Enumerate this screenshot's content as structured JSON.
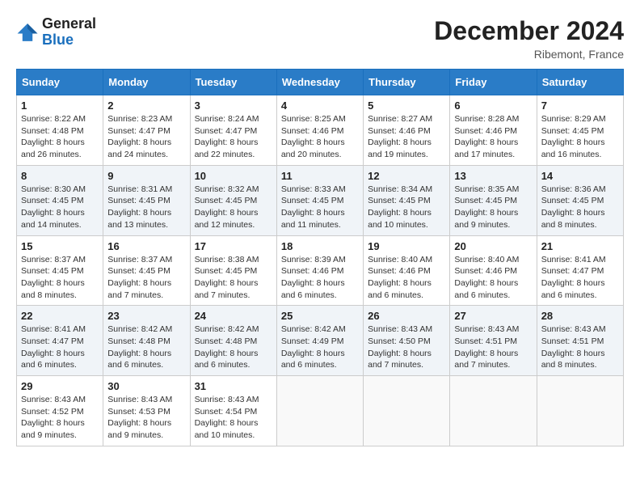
{
  "header": {
    "logo_line1": "General",
    "logo_line2": "Blue",
    "month_year": "December 2024",
    "location": "Ribemont, France"
  },
  "weekdays": [
    "Sunday",
    "Monday",
    "Tuesday",
    "Wednesday",
    "Thursday",
    "Friday",
    "Saturday"
  ],
  "weeks": [
    [
      {
        "day": "1",
        "sunrise": "Sunrise: 8:22 AM",
        "sunset": "Sunset: 4:48 PM",
        "daylight": "Daylight: 8 hours and 26 minutes."
      },
      {
        "day": "2",
        "sunrise": "Sunrise: 8:23 AM",
        "sunset": "Sunset: 4:47 PM",
        "daylight": "Daylight: 8 hours and 24 minutes."
      },
      {
        "day": "3",
        "sunrise": "Sunrise: 8:24 AM",
        "sunset": "Sunset: 4:47 PM",
        "daylight": "Daylight: 8 hours and 22 minutes."
      },
      {
        "day": "4",
        "sunrise": "Sunrise: 8:25 AM",
        "sunset": "Sunset: 4:46 PM",
        "daylight": "Daylight: 8 hours and 20 minutes."
      },
      {
        "day": "5",
        "sunrise": "Sunrise: 8:27 AM",
        "sunset": "Sunset: 4:46 PM",
        "daylight": "Daylight: 8 hours and 19 minutes."
      },
      {
        "day": "6",
        "sunrise": "Sunrise: 8:28 AM",
        "sunset": "Sunset: 4:46 PM",
        "daylight": "Daylight: 8 hours and 17 minutes."
      },
      {
        "day": "7",
        "sunrise": "Sunrise: 8:29 AM",
        "sunset": "Sunset: 4:45 PM",
        "daylight": "Daylight: 8 hours and 16 minutes."
      }
    ],
    [
      {
        "day": "8",
        "sunrise": "Sunrise: 8:30 AM",
        "sunset": "Sunset: 4:45 PM",
        "daylight": "Daylight: 8 hours and 14 minutes."
      },
      {
        "day": "9",
        "sunrise": "Sunrise: 8:31 AM",
        "sunset": "Sunset: 4:45 PM",
        "daylight": "Daylight: 8 hours and 13 minutes."
      },
      {
        "day": "10",
        "sunrise": "Sunrise: 8:32 AM",
        "sunset": "Sunset: 4:45 PM",
        "daylight": "Daylight: 8 hours and 12 minutes."
      },
      {
        "day": "11",
        "sunrise": "Sunrise: 8:33 AM",
        "sunset": "Sunset: 4:45 PM",
        "daylight": "Daylight: 8 hours and 11 minutes."
      },
      {
        "day": "12",
        "sunrise": "Sunrise: 8:34 AM",
        "sunset": "Sunset: 4:45 PM",
        "daylight": "Daylight: 8 hours and 10 minutes."
      },
      {
        "day": "13",
        "sunrise": "Sunrise: 8:35 AM",
        "sunset": "Sunset: 4:45 PM",
        "daylight": "Daylight: 8 hours and 9 minutes."
      },
      {
        "day": "14",
        "sunrise": "Sunrise: 8:36 AM",
        "sunset": "Sunset: 4:45 PM",
        "daylight": "Daylight: 8 hours and 8 minutes."
      }
    ],
    [
      {
        "day": "15",
        "sunrise": "Sunrise: 8:37 AM",
        "sunset": "Sunset: 4:45 PM",
        "daylight": "Daylight: 8 hours and 8 minutes."
      },
      {
        "day": "16",
        "sunrise": "Sunrise: 8:37 AM",
        "sunset": "Sunset: 4:45 PM",
        "daylight": "Daylight: 8 hours and 7 minutes."
      },
      {
        "day": "17",
        "sunrise": "Sunrise: 8:38 AM",
        "sunset": "Sunset: 4:45 PM",
        "daylight": "Daylight: 8 hours and 7 minutes."
      },
      {
        "day": "18",
        "sunrise": "Sunrise: 8:39 AM",
        "sunset": "Sunset: 4:46 PM",
        "daylight": "Daylight: 8 hours and 6 minutes."
      },
      {
        "day": "19",
        "sunrise": "Sunrise: 8:40 AM",
        "sunset": "Sunset: 4:46 PM",
        "daylight": "Daylight: 8 hours and 6 minutes."
      },
      {
        "day": "20",
        "sunrise": "Sunrise: 8:40 AM",
        "sunset": "Sunset: 4:46 PM",
        "daylight": "Daylight: 8 hours and 6 minutes."
      },
      {
        "day": "21",
        "sunrise": "Sunrise: 8:41 AM",
        "sunset": "Sunset: 4:47 PM",
        "daylight": "Daylight: 8 hours and 6 minutes."
      }
    ],
    [
      {
        "day": "22",
        "sunrise": "Sunrise: 8:41 AM",
        "sunset": "Sunset: 4:47 PM",
        "daylight": "Daylight: 8 hours and 6 minutes."
      },
      {
        "day": "23",
        "sunrise": "Sunrise: 8:42 AM",
        "sunset": "Sunset: 4:48 PM",
        "daylight": "Daylight: 8 hours and 6 minutes."
      },
      {
        "day": "24",
        "sunrise": "Sunrise: 8:42 AM",
        "sunset": "Sunset: 4:48 PM",
        "daylight": "Daylight: 8 hours and 6 minutes."
      },
      {
        "day": "25",
        "sunrise": "Sunrise: 8:42 AM",
        "sunset": "Sunset: 4:49 PM",
        "daylight": "Daylight: 8 hours and 6 minutes."
      },
      {
        "day": "26",
        "sunrise": "Sunrise: 8:43 AM",
        "sunset": "Sunset: 4:50 PM",
        "daylight": "Daylight: 8 hours and 7 minutes."
      },
      {
        "day": "27",
        "sunrise": "Sunrise: 8:43 AM",
        "sunset": "Sunset: 4:51 PM",
        "daylight": "Daylight: 8 hours and 7 minutes."
      },
      {
        "day": "28",
        "sunrise": "Sunrise: 8:43 AM",
        "sunset": "Sunset: 4:51 PM",
        "daylight": "Daylight: 8 hours and 8 minutes."
      }
    ],
    [
      {
        "day": "29",
        "sunrise": "Sunrise: 8:43 AM",
        "sunset": "Sunset: 4:52 PM",
        "daylight": "Daylight: 8 hours and 9 minutes."
      },
      {
        "day": "30",
        "sunrise": "Sunrise: 8:43 AM",
        "sunset": "Sunset: 4:53 PM",
        "daylight": "Daylight: 8 hours and 9 minutes."
      },
      {
        "day": "31",
        "sunrise": "Sunrise: 8:43 AM",
        "sunset": "Sunset: 4:54 PM",
        "daylight": "Daylight: 8 hours and 10 minutes."
      },
      null,
      null,
      null,
      null
    ]
  ]
}
